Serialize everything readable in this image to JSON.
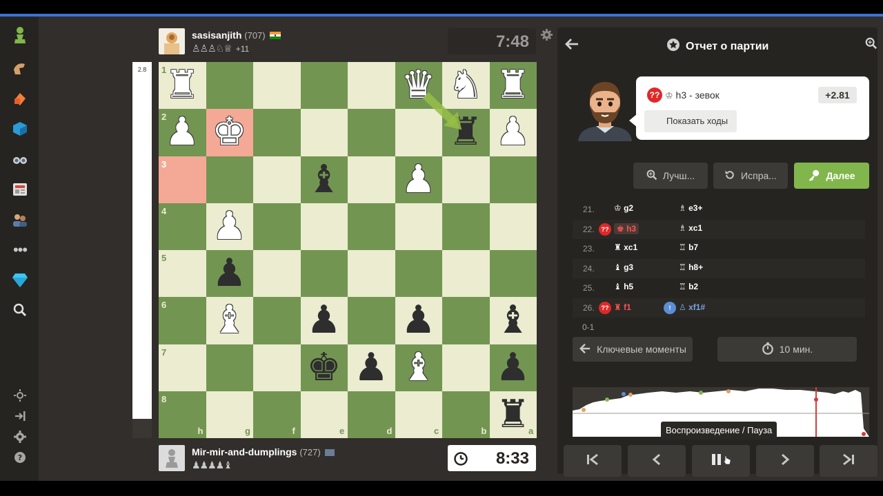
{
  "top_player": {
    "name": "sasisanjith",
    "rating": "(707)",
    "captured": "♙♙♙♘♕",
    "advantage": "+11",
    "clock": "7:48"
  },
  "bottom_player": {
    "name": "Mir-mir-and-dumplings",
    "rating": "(727)",
    "captured": "♟♟♟♟♝",
    "clock": "8:33"
  },
  "eval_bar": {
    "label": "2.8",
    "white_fraction": 0.95
  },
  "board": {
    "ranks": [
      "1",
      "2",
      "3",
      "4",
      "5",
      "6",
      "7",
      "8"
    ],
    "files": [
      "h",
      "g",
      "f",
      "e",
      "d",
      "c",
      "b",
      "a"
    ],
    "pieces": {
      "wr_h1": "♜",
      "wq_c1": "♛",
      "wn_b1": "♞",
      "wr_a1": "♜",
      "wp_h2": "♟",
      "wk_g2": "♚",
      "br_b2": "♜",
      "wp_a2": "♟",
      "bb_e3": "♝",
      "wp_c3": "♟",
      "wp_g4": "♟",
      "bp_g5": "♟",
      "wb_g6": "♝",
      "bp_e6": "♟",
      "bp_c6": "♟",
      "bb_a6": "♝",
      "bk_e7": "♚",
      "bp_d7": "♟",
      "wb_c7": "♝",
      "bp_a7": "♟",
      "br_a8": "♜"
    }
  },
  "panel": {
    "title": "Отчет о партии",
    "bubble_move": "h3 - зевок",
    "bubble_piece": "♔",
    "eval": "+2.81",
    "show_moves": "Показать ходы",
    "btn_best": "Лучш...",
    "btn_retry": "Испра...",
    "btn_next": "Далее",
    "moves": [
      {
        "num": "21.",
        "w_piece": "♔",
        "w": "g2",
        "b_piece": "♗",
        "b": "e3+"
      },
      {
        "num": "22.",
        "w_piece": "♚",
        "w": "h3",
        "b_piece": "♗",
        "b": "xc1"
      },
      {
        "num": "23.",
        "w_piece": "♜",
        "w": "xc1",
        "b_piece": "♖",
        "b": "b7"
      },
      {
        "num": "24.",
        "w_piece": "♝",
        "w": "g3",
        "b_piece": "♖",
        "b": "h8+"
      },
      {
        "num": "25.",
        "w_piece": "♝",
        "w": "h5",
        "b_piece": "♖",
        "b": "b2"
      },
      {
        "num": "26.",
        "w_piece": "♜",
        "w": "f1",
        "b_piece": "♙",
        "b": "xf1#"
      }
    ],
    "blunder_mark": "??",
    "info_mark": "!",
    "result": "0-1",
    "btn_key_moments": "Ключевые моменты",
    "btn_time": "10 мин.",
    "tooltip": "Воспроизведение / Пауза"
  },
  "colors": {
    "board_light": "#ebecd0",
    "board_dark": "#739552",
    "highlight": "#ec8a72",
    "accent_green": "#81b64c",
    "blunder_red": "#e02828"
  },
  "icons": [
    "pawn-logo-icon",
    "puzzle-hand-icon",
    "lessons-icon",
    "learn-cube-icon",
    "binoculars-icon",
    "news-icon",
    "social-icon",
    "more-icon",
    "diamond-icon",
    "search-icon",
    "sun-icon",
    "login-icon",
    "settings-icon",
    "help-icon"
  ]
}
